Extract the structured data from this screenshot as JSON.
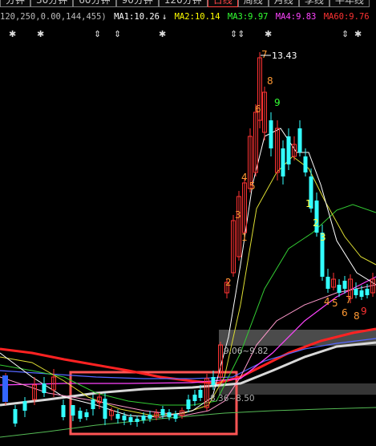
{
  "tabs": [
    {
      "label": "分钟",
      "active": false
    },
    {
      "label": "30分钟",
      "active": false
    },
    {
      "label": "60分钟",
      "active": false
    },
    {
      "label": "90分钟",
      "active": false
    },
    {
      "label": "120分钟",
      "active": false
    },
    {
      "label": "日线",
      "active": true
    },
    {
      "label": "周线",
      "active": false
    },
    {
      "label": "月线",
      "active": false
    },
    {
      "label": "季线",
      "active": false
    },
    {
      "label": "半年线",
      "active": false
    }
  ],
  "indicator_params": "120,250,0.00,144,455)",
  "ma": [
    {
      "label": "MA1:10.26",
      "arrow": "↓",
      "color": "#ffffff"
    },
    {
      "label": "MA2:10.14",
      "arrow": "",
      "color": "#ffff00"
    },
    {
      "label": "MA3:9.97",
      "arrow": "",
      "color": "#33ff33"
    },
    {
      "label": "MA4:9.83",
      "arrow": "",
      "color": "#ff44ff"
    },
    {
      "label": "MA60:9.76",
      "arrow": "",
      "color": "#ff3333"
    }
  ],
  "signal_markers": [
    "✱",
    "✱",
    "⇕",
    "⇕",
    "✱",
    "⇕⇕",
    "✱",
    "⇕",
    "✱"
  ],
  "annotations": {
    "high_price": "13.43",
    "band_upper": "9.06~9.82",
    "band_lower": "8.36~8.50"
  },
  "wave_counts": [
    {
      "text": "7",
      "color": "#ff9933"
    },
    {
      "text": "8",
      "color": "#ff9933"
    },
    {
      "text": "6",
      "color": "#ff9933"
    },
    {
      "text": "9",
      "color": "#33ff33"
    },
    {
      "text": "4",
      "color": "#ff9933"
    },
    {
      "text": "5",
      "color": "#ff9933"
    },
    {
      "text": "3",
      "color": "#ff9933"
    },
    {
      "text": "2",
      "color": "#ff9933"
    },
    {
      "text": "1",
      "color": "#ff9933"
    },
    {
      "text": "1",
      "color": "#ffff44"
    },
    {
      "text": "2",
      "color": "#ffff44"
    },
    {
      "text": "3",
      "color": "#ffff44"
    },
    {
      "text": "4",
      "color": "#ff9933"
    },
    {
      "text": "5",
      "color": "#ff9933"
    },
    {
      "text": "6",
      "color": "#ff9933"
    },
    {
      "text": "7",
      "color": "#ff9933"
    },
    {
      "text": "8",
      "color": "#ff9933"
    },
    {
      "text": "9",
      "color": "#ff3333"
    }
  ],
  "colors": {
    "up": "#ff3333",
    "down": "#33ffff",
    "highlight_box": "#ff5555"
  }
}
